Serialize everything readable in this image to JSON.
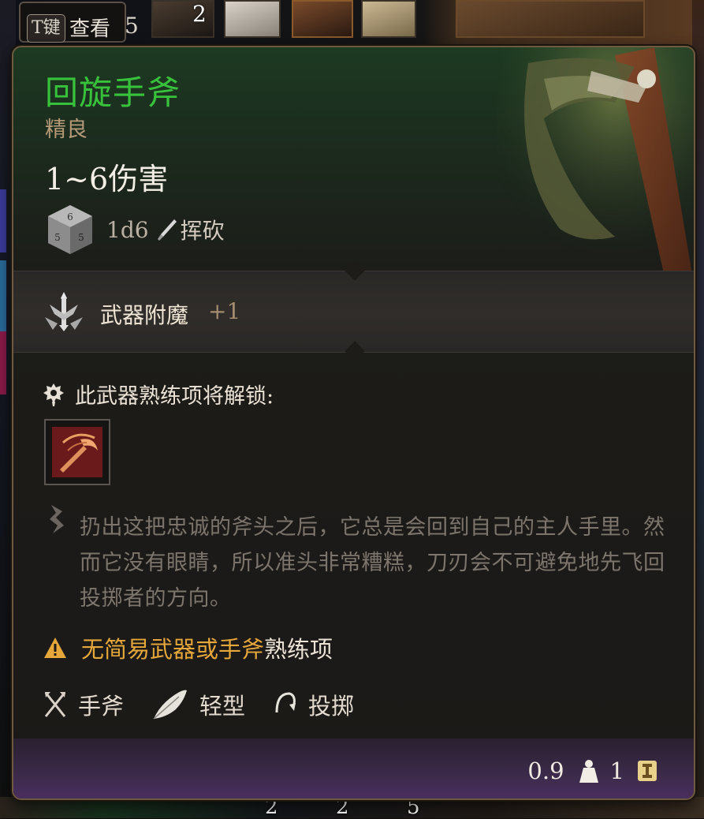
{
  "hotbar": {
    "hint_key": "T键",
    "hint_label": "查看",
    "hint_count": "5",
    "slot_counts": [
      "2"
    ]
  },
  "bottom_bar": {
    "counts": [
      "2",
      "2",
      "5"
    ]
  },
  "tooltip": {
    "name": "回旋手斧",
    "rarity": "精良",
    "damage": "1~6伤害",
    "dice": "1d6",
    "damage_type": "挥砍",
    "enchant_label": "武器附魔",
    "enchant_value": "+1",
    "proficiency_unlock": "此武器熟练项将解锁:",
    "description": "扔出这把忠诚的斧头之后，它总是会回到自己的主人手里。然而它没有眼睛，所以准头非常糟糕，刀刃会不可避免地先飞回投掷者的方向。",
    "warning_highlight": "无简易武器或手斧",
    "warning_rest": "熟练项",
    "properties": [
      {
        "label": "手斧",
        "icon": "crossed-axes-icon"
      },
      {
        "label": "轻型",
        "icon": "feather-icon"
      },
      {
        "label": "投掷",
        "icon": "throw-arc-icon"
      }
    ],
    "weight": "0.9",
    "value": "1"
  },
  "colors": {
    "name": "#38c23c",
    "rarity": "#b59a78",
    "warning": "#e5a63a",
    "footer": "#4a2f5e"
  }
}
